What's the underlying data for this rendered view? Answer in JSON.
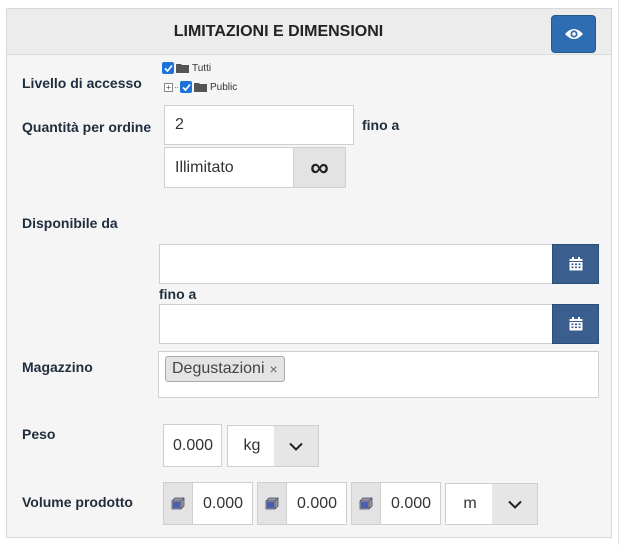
{
  "header": {
    "title": "LIMITAZIONI E DIMENSIONI",
    "toggle_icon": "eye-icon"
  },
  "access": {
    "label": "Livello di accesso",
    "tree": [
      {
        "label": "Tutti",
        "checked": true
      },
      {
        "label": "Public",
        "checked": true
      }
    ]
  },
  "quantity": {
    "label": "Quantità per ordine",
    "min_value": "2",
    "to_label": "fino a",
    "max_value": "Illimitato",
    "infinity_symbol": "∞"
  },
  "available": {
    "label": "Disponibile da",
    "from_value": "",
    "to_label": "fino a",
    "to_value": "",
    "calendar_icon": "calendar-icon"
  },
  "warehouse": {
    "label": "Magazzino",
    "tags": [
      {
        "label": "Degustazioni",
        "remove": "×"
      }
    ]
  },
  "weight": {
    "label": "Peso",
    "value": "0.000",
    "unit": "kg"
  },
  "volume": {
    "label": "Volume prodotto",
    "values": [
      "0.000",
      "0.000",
      "0.000"
    ],
    "unit": "m",
    "dimension_icon": "cube-icon"
  },
  "colors": {
    "accent": "#2f6db3",
    "calendar": "#3a5f8f",
    "checkbox": "#1e73d9"
  }
}
